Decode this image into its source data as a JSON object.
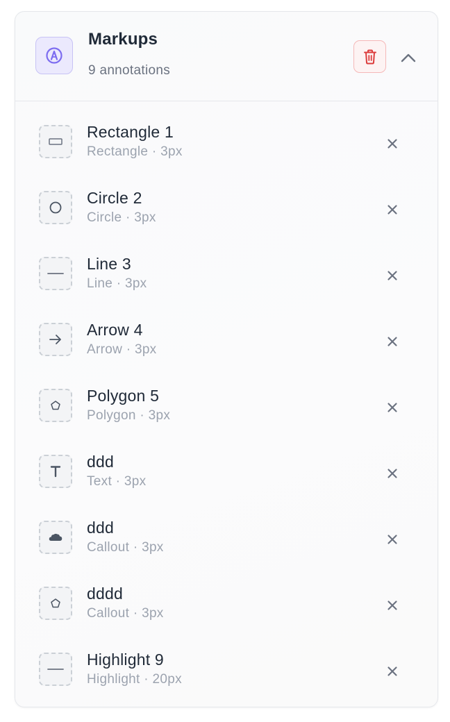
{
  "panel": {
    "title": "Markups",
    "subtitle": "9 annotations",
    "header_icon": "markup-pen-icon",
    "delete_icon": "trash-icon",
    "collapse_icon": "chevron-up-icon"
  },
  "colors": {
    "accent": "#7c6cf0",
    "danger": "#dc3c3c",
    "text_primary": "#1f2937",
    "text_secondary": "#9ca3af"
  },
  "annotations": [
    {
      "name": "Rectangle 1",
      "type": "Rectangle",
      "separator": "·",
      "stroke": "3px",
      "icon": "rectangle-icon"
    },
    {
      "name": "Circle 2",
      "type": "Circle",
      "separator": "·",
      "stroke": "3px",
      "icon": "circle-icon"
    },
    {
      "name": "Line 3",
      "type": "Line",
      "separator": "·",
      "stroke": "3px",
      "icon": "line-icon"
    },
    {
      "name": "Arrow 4",
      "type": "Arrow",
      "separator": "·",
      "stroke": "3px",
      "icon": "arrow-right-icon"
    },
    {
      "name": "Polygon 5",
      "type": "Polygon",
      "separator": "·",
      "stroke": "3px",
      "icon": "pentagon-icon"
    },
    {
      "name": "ddd",
      "type": "Text",
      "separator": "·",
      "stroke": "3px",
      "icon": "text-icon"
    },
    {
      "name": "ddd",
      "type": "Callout",
      "separator": "·",
      "stroke": "3px",
      "icon": "cloud-icon"
    },
    {
      "name": "dddd",
      "type": "Callout",
      "separator": "·",
      "stroke": "3px",
      "icon": "pentagon-icon"
    },
    {
      "name": "Highlight 9",
      "type": "Highlight",
      "separator": "·",
      "stroke": "20px",
      "icon": "line-icon"
    }
  ],
  "remove_icon": "close-icon"
}
